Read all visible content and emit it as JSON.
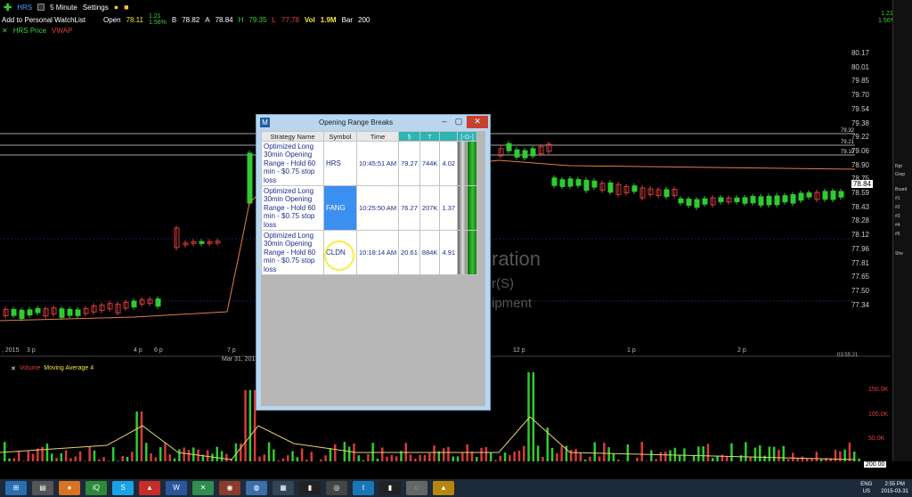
{
  "toolbar": {
    "symbol": "HRS",
    "interval": "5 Minute",
    "settings_label": "Settings",
    "watchlist_link": "Add to Personal WatchList",
    "open_label": "Open",
    "open_value": "78.11",
    "change_value": "1.21",
    "change_pct": "1.56%",
    "bid_label": "B",
    "bid_value": "78.82",
    "ask_label": "A",
    "ask_value": "78.84",
    "high_label": "H",
    "high_value": "79.35",
    "low_label": "L",
    "low_value": "77.78",
    "vol_label": "Vol",
    "vol_value": "1.9M",
    "bar_label": "Bar",
    "bar_value": "200",
    "price_legend": "HRS Price",
    "vwap_legend": "VWAP",
    "right_change": "1.21",
    "right_pct": "1.56%"
  },
  "chart": {
    "y_ticks": [
      "80.17",
      "80.01",
      "79.85",
      "79.70",
      "79.54",
      "79.38",
      "79.22",
      "79.06",
      "78.90",
      "78.75",
      "78.59",
      "78.43",
      "78.28",
      "78.12",
      "77.96",
      "77.81",
      "77.65",
      "77.50",
      "77.34"
    ],
    "last_price_tag": "78.84",
    "levels": [
      "79.32",
      "79.21",
      "79.10"
    ],
    "x_ticks": [
      "3 p",
      "4 p",
      "6 p",
      "7 p",
      "Mar 31, 2015",
      "12 p",
      "1 p",
      "2 p"
    ],
    "left_edge_label": ", 2015",
    "corner_time": "03:55:21",
    "volume_ticks": [
      "150.0K",
      "100.0K",
      "50.0K"
    ],
    "volume_last": "200.00",
    "volume_legend": "Volume",
    "ma_legend": "Moving Average 4",
    "watermark_line1": "ration",
    "watermark_line2": "r(S)",
    "watermark_line3": "ipment",
    "colors": {
      "up": "#2ecc2e",
      "down": "#d83a3a",
      "vwap": "#e0804a",
      "volume_ma": "#e8d070"
    }
  },
  "dialog": {
    "icon_letter": "M",
    "title": "Opening Range Breaks",
    "headers": [
      "Strategy Name",
      "Symbol",
      "Time",
      "§",
      "T",
      "",
      "[-D-]"
    ],
    "rows": [
      {
        "strategy": "Optimized Long 30min Opening Range - Hold 60 min - $0.75 stop loss",
        "symbol": "HRS",
        "time": "10:45:51 AM",
        "price": "79.27",
        "volume": "744K",
        "ratio": "4.02"
      },
      {
        "strategy": "Optimized Long 30min Opening Range - Hold 60 min - $0.75 stop loss",
        "symbol": "FANG",
        "time": "10:25:50 AM",
        "price": "76.27",
        "volume": "207K",
        "ratio": "1.37"
      },
      {
        "strategy": "Optimized Long 30min Opening Range - Hold 60 min - $0.75 stop loss",
        "symbol": "CLDN",
        "time": "10:18:14 AM",
        "price": "20.61",
        "volume": "884K",
        "ratio": "4.91"
      }
    ],
    "selected_row": 1
  },
  "rightbar": {
    "tags": [
      "#1",
      "#2",
      "#3",
      "#4",
      "#5",
      "Rpt",
      "Grap",
      "Board",
      "She"
    ]
  },
  "taskbar": {
    "lang": "ENG",
    "region": "US",
    "time": "2:55 PM",
    "date": "2015-03-31",
    "apps": [
      "iQ",
      "S",
      "W"
    ]
  }
}
